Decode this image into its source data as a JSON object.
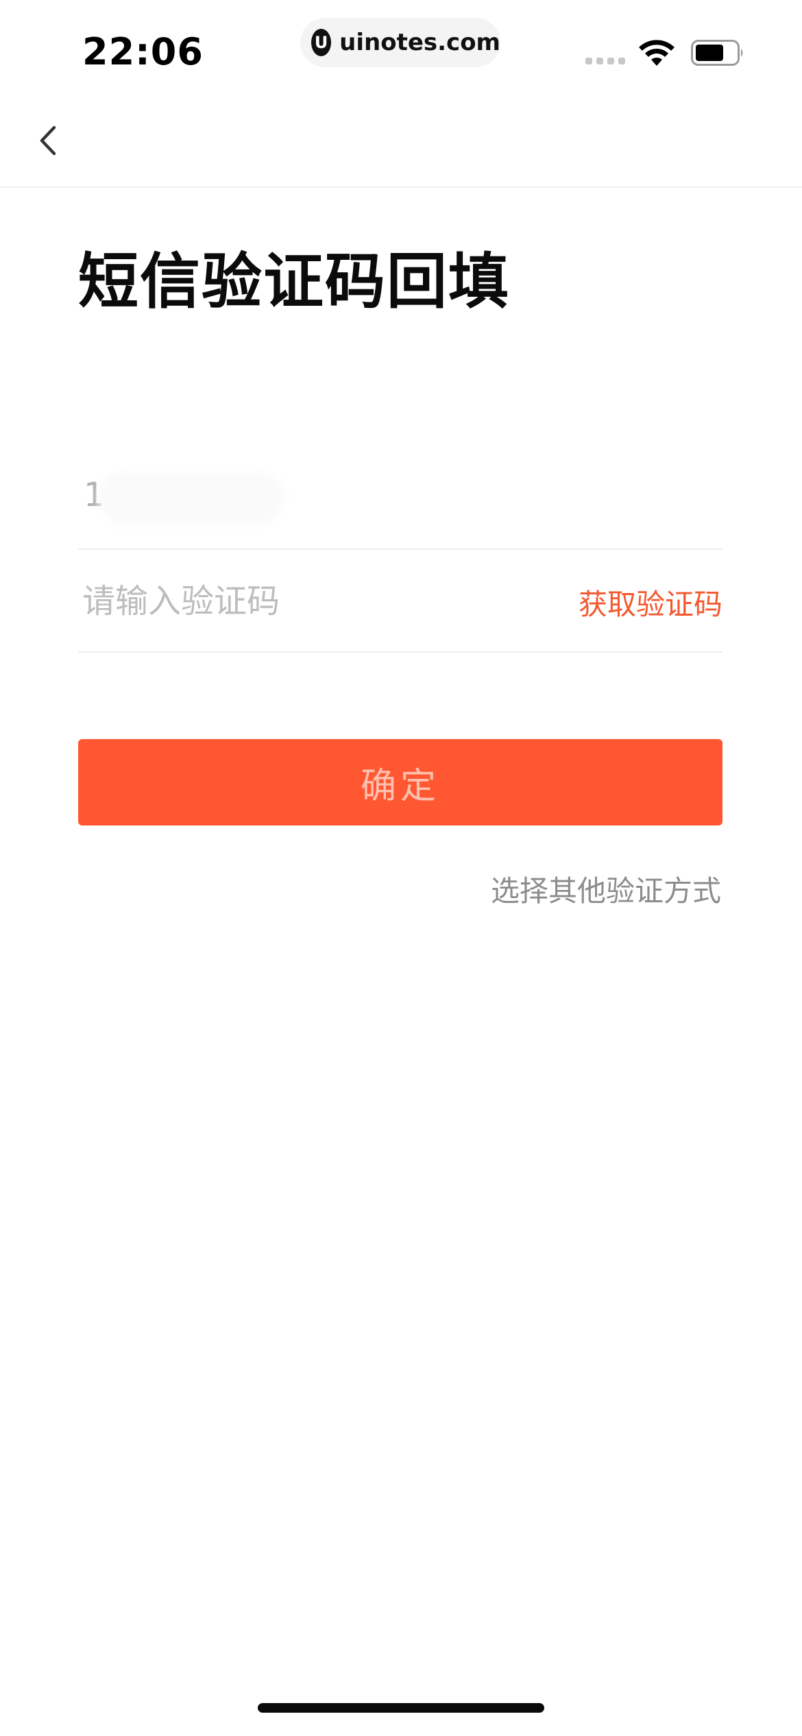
{
  "status_bar": {
    "time": "22:06",
    "url": "uinotes.com",
    "logo_glyph": "U"
  },
  "nav": {
    "back_icon": "chevron-left-icon"
  },
  "page": {
    "title": "短信验证码回填"
  },
  "form": {
    "phone_prefix": "1",
    "code_placeholder": "请输入验证码",
    "get_code_label": "获取验证码",
    "confirm_label": "确定",
    "other_method_label": "选择其他验证方式"
  },
  "colors": {
    "accent": "#ff5731",
    "link": "#f4582e",
    "button_text": "#ffc1b0",
    "muted": "#8c8c8c"
  }
}
